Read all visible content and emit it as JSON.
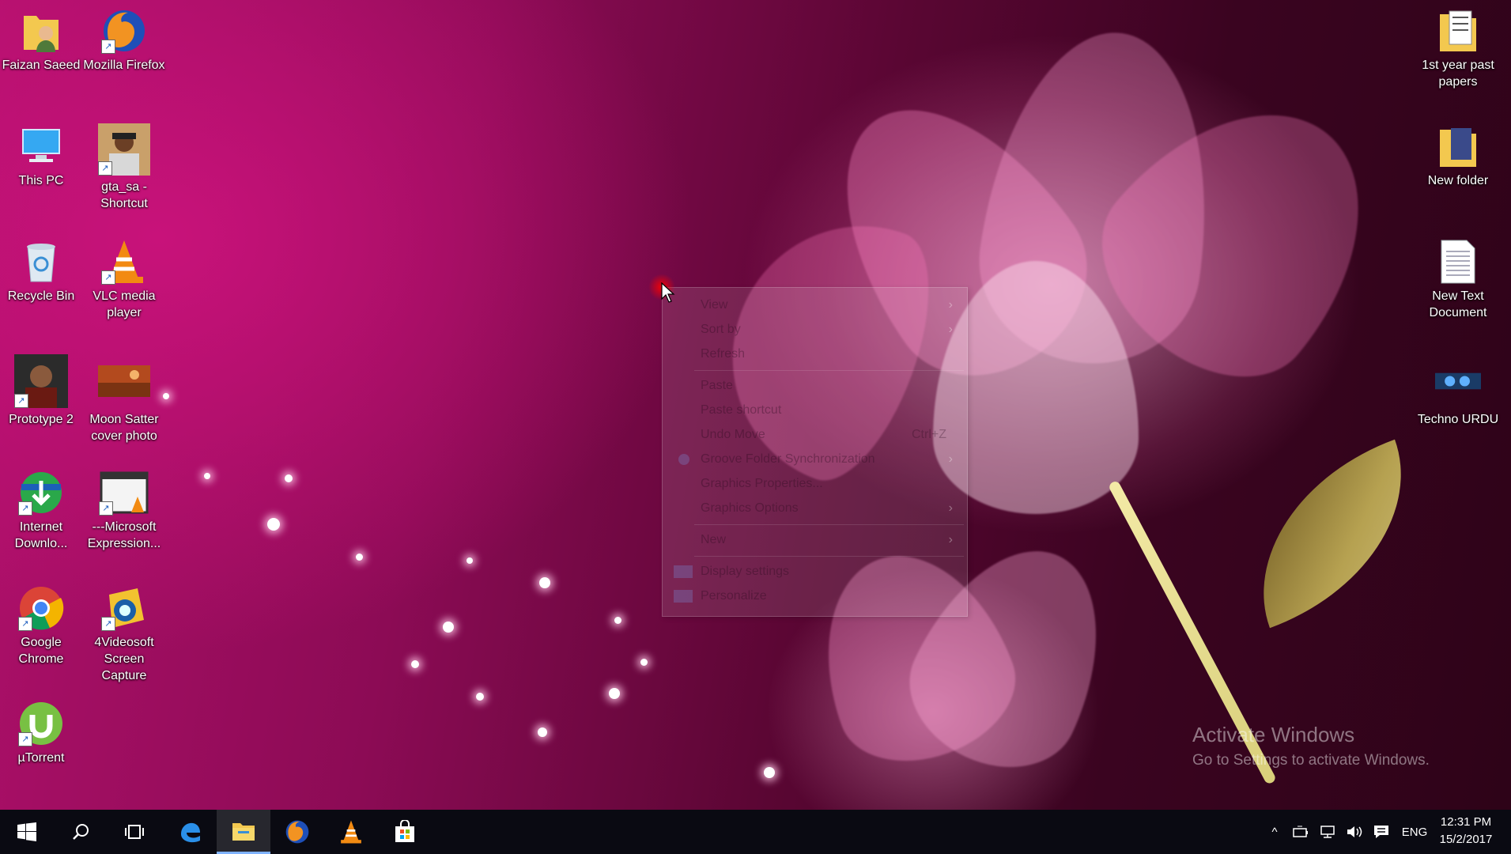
{
  "desktop_icons_left": [
    {
      "label": "Faizan Saeed",
      "icon": "user-folder-icon"
    },
    {
      "label": "Mozilla Firefox",
      "icon": "firefox-icon"
    },
    {
      "label": "This PC",
      "icon": "computer-icon"
    },
    {
      "label": "gta_sa - Shortcut",
      "icon": "gta-icon"
    },
    {
      "label": "Recycle Bin",
      "icon": "recycle-bin-icon"
    },
    {
      "label": "VLC media player",
      "icon": "vlc-icon"
    },
    {
      "label": "Prototype 2",
      "icon": "prototype-icon"
    },
    {
      "label": "Moon Satter cover photo",
      "icon": "photo-icon"
    },
    {
      "label": "Internet Downlo...",
      "icon": "idm-icon"
    },
    {
      "label": "---Microsoft Expression...",
      "icon": "expression-icon"
    },
    {
      "label": "Google Chrome",
      "icon": "chrome-icon"
    },
    {
      "label": "4Videosoft Screen Capture",
      "icon": "screen-capture-icon"
    },
    {
      "label": "µTorrent",
      "icon": "utorrent-icon"
    }
  ],
  "desktop_icons_right": [
    {
      "label": "1st year past papers",
      "icon": "folder-icon"
    },
    {
      "label": "New folder",
      "icon": "folder-icon"
    },
    {
      "label": "New Text Document",
      "icon": "text-document-icon"
    },
    {
      "label": "Techno URDU",
      "icon": "image-icon"
    }
  ],
  "context_menu": {
    "items": [
      {
        "label": "View",
        "submenu": true
      },
      {
        "label": "Sort by",
        "submenu": true
      },
      {
        "label": "Refresh"
      },
      {
        "label": "Paste"
      },
      {
        "label": "Paste shortcut"
      },
      {
        "label": "Undo Move",
        "shortcut": "Ctrl+Z"
      },
      {
        "label": "Groove Folder Synchronization",
        "submenu": true
      },
      {
        "label": "Graphics Properties..."
      },
      {
        "label": "Graphics Options",
        "submenu": true
      },
      {
        "label": "New",
        "submenu": true
      },
      {
        "label": "Display settings"
      },
      {
        "label": "Personalize"
      }
    ]
  },
  "watermark": {
    "title": "Activate Windows",
    "subtitle": "Go to Settings to activate Windows."
  },
  "taskbar": {
    "pinned": [
      "start-icon",
      "search-icon",
      "task-view-icon",
      "edge-icon",
      "file-explorer-icon",
      "firefox-icon",
      "vlc-icon",
      "store-icon"
    ],
    "language": "ENG",
    "time": "12:31 PM",
    "date": "15/2/2017"
  },
  "colors": {
    "accent": "#c8127a",
    "taskbar": "#0a0a12"
  }
}
